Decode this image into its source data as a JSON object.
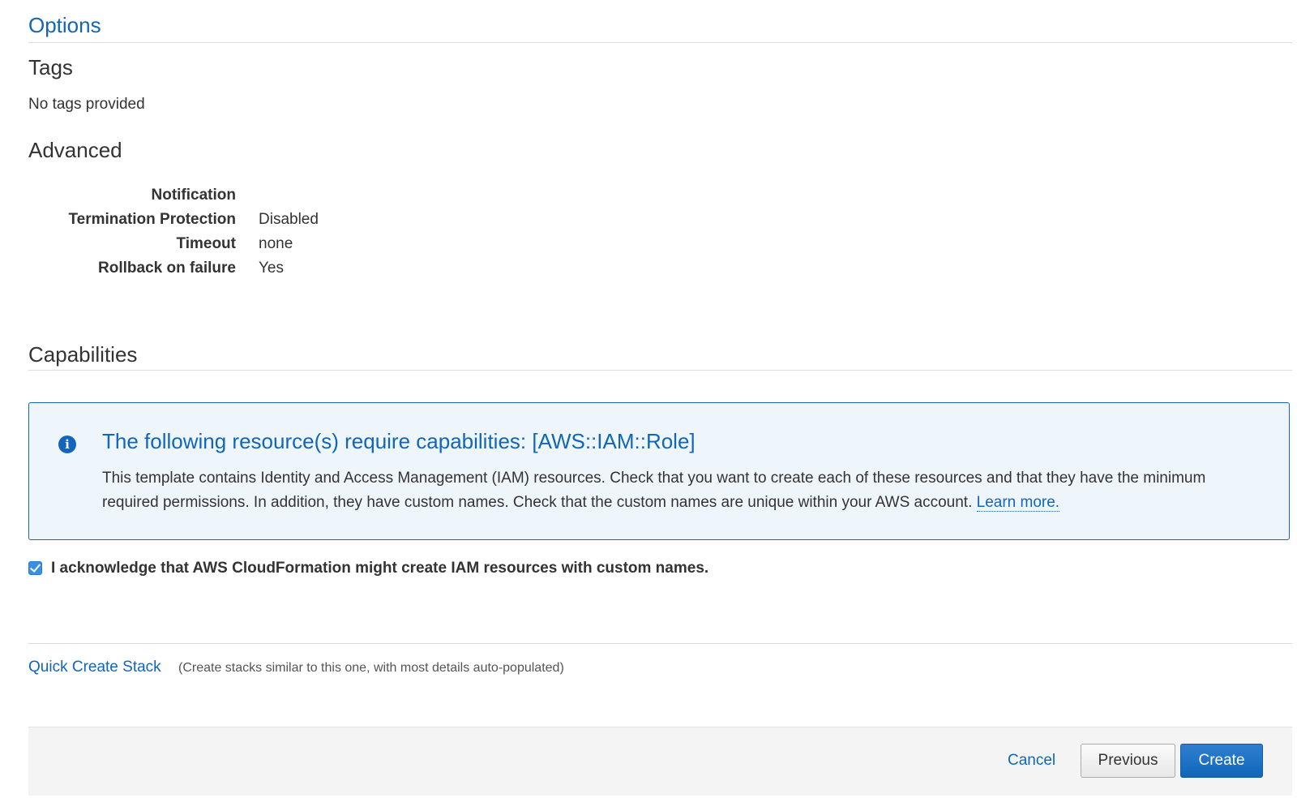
{
  "options": {
    "label": "Options"
  },
  "tags": {
    "heading": "Tags",
    "empty_text": "No tags provided"
  },
  "advanced": {
    "heading": "Advanced",
    "rows": [
      {
        "key": "Notification",
        "value": ""
      },
      {
        "key": "Termination Protection",
        "value": "Disabled"
      },
      {
        "key": "Timeout",
        "value": "none"
      },
      {
        "key": "Rollback on failure",
        "value": "Yes"
      }
    ]
  },
  "capabilities": {
    "heading": "Capabilities",
    "info": {
      "icon": "info-icon",
      "icon_glyph": "i",
      "title": "The following resource(s) require capabilities: [AWS::IAM::Role]",
      "body": "This template contains Identity and Access Management (IAM) resources. Check that you want to create each of these resources and that they have the minimum required permissions. In addition, they have custom names. Check that the custom names are unique within your AWS account.",
      "learn_more": "Learn more."
    },
    "acknowledge": {
      "checked": true,
      "label": "I acknowledge that AWS CloudFormation might create IAM resources with custom names."
    }
  },
  "quick_create": {
    "link": "Quick Create Stack",
    "note": "(Create stacks similar to this one, with most details auto-populated)"
  },
  "footer": {
    "cancel": "Cancel",
    "previous": "Previous",
    "create": "Create"
  },
  "colors": {
    "accent": "#1166bb",
    "info_bg": "#eef6fc",
    "checkbox": "#3a8ee6",
    "footer_bg": "#f4f4f4"
  }
}
